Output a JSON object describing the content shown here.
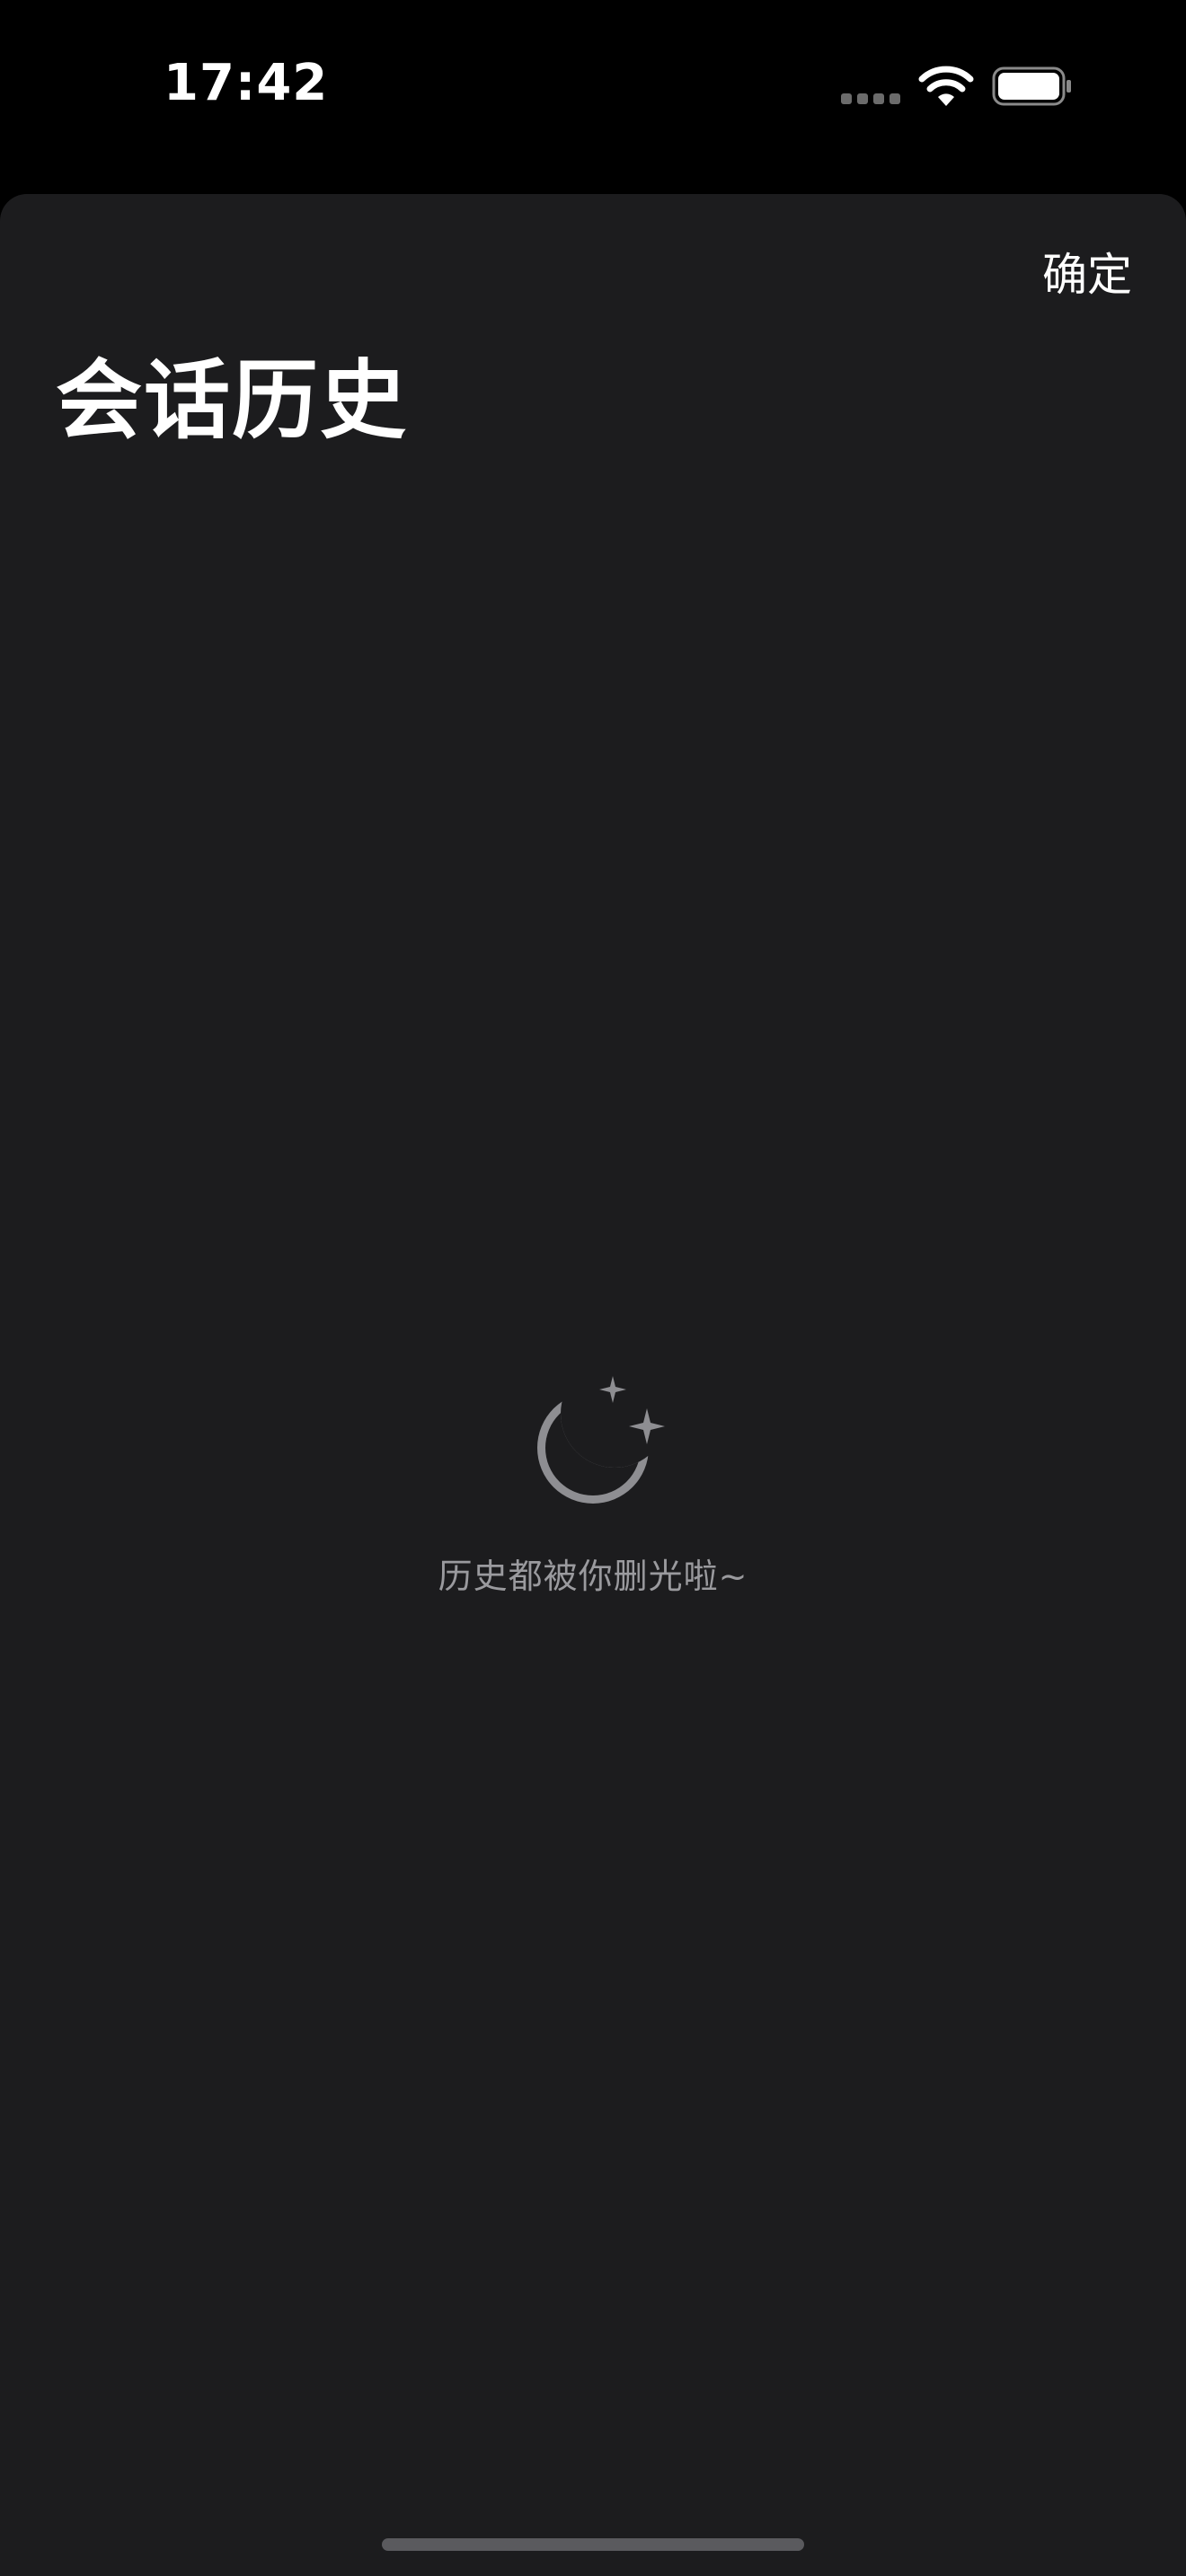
{
  "status_bar": {
    "time": "17:42",
    "icons": [
      "cellular-signal-icon",
      "wifi-icon",
      "battery-icon"
    ]
  },
  "sheet": {
    "confirm_label": "确定",
    "title": "会话历史",
    "empty_state": {
      "icon": "moon-stars-icon",
      "message": "历史都被你删光啦~"
    }
  },
  "colors": {
    "background": "#000000",
    "sheet_background": "#1c1c1e",
    "primary_text": "#ffffff",
    "secondary_text": "#9a9a9e",
    "icon_gray": "#8e8e92"
  }
}
